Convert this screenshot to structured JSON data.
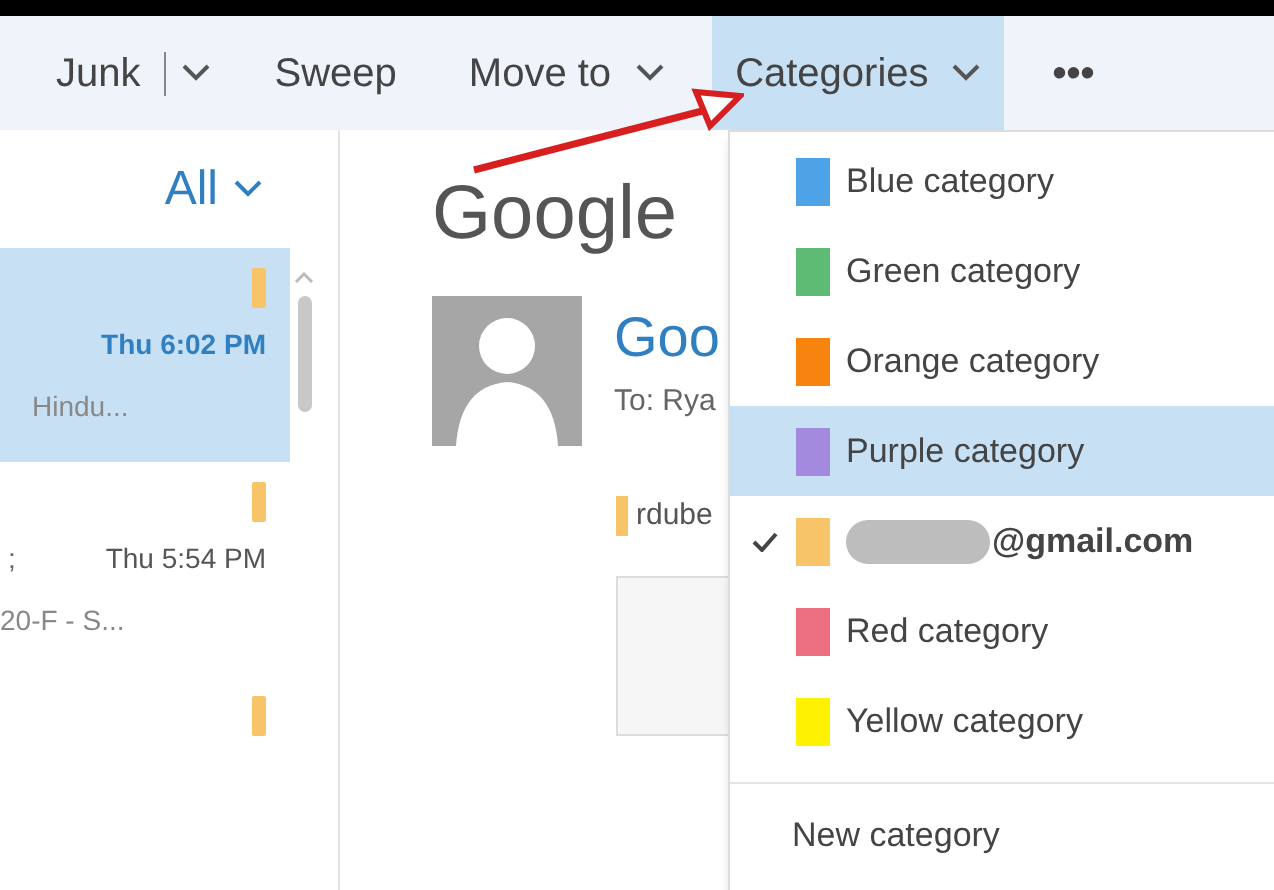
{
  "toolbar": {
    "items": [
      {
        "label": "Junk",
        "kind": "split",
        "selected": false
      },
      {
        "label": "Sweep",
        "kind": "plain",
        "selected": false
      },
      {
        "label": "Move to",
        "kind": "dropdown",
        "selected": false
      },
      {
        "label": "Categories",
        "kind": "dropdown",
        "selected": true
      },
      {
        "label": "•••",
        "kind": "more",
        "selected": false
      }
    ]
  },
  "message_list": {
    "filter": "All",
    "messages": [
      {
        "time": "Thu 6:02 PM",
        "preview": "Hindu...",
        "selected": true
      },
      {
        "prefix": ";",
        "time": "Thu 5:54 PM",
        "preview": "20-F - S...",
        "selected": false
      },
      {
        "selected": false
      }
    ]
  },
  "reading_pane": {
    "subject": "Google",
    "sender": "Goo",
    "to": "To: Rya",
    "category_tag": "rdube"
  },
  "categories_menu": {
    "items": [
      {
        "kind": "category",
        "label": "Blue category",
        "color": "#4da3e6",
        "checked": false,
        "selected": false
      },
      {
        "kind": "category",
        "label": "Green category",
        "color": "#5dbb74",
        "checked": false,
        "selected": false
      },
      {
        "kind": "category",
        "label": "Orange category",
        "color": "#f7840f",
        "checked": false,
        "selected": false
      },
      {
        "kind": "category",
        "label": "Purple category",
        "color": "#a48ade",
        "checked": false,
        "selected": true
      },
      {
        "kind": "redacted",
        "label": "@gmail.com",
        "color": "#f8c46a",
        "checked": true,
        "selected": false
      },
      {
        "kind": "category",
        "label": "Red category",
        "color": "#ec6f7f",
        "checked": false,
        "selected": false
      },
      {
        "kind": "category",
        "label": "Yellow category",
        "color": "#fff200",
        "checked": false,
        "selected": false
      },
      {
        "kind": "action",
        "label": "New category",
        "selected": false
      }
    ]
  }
}
